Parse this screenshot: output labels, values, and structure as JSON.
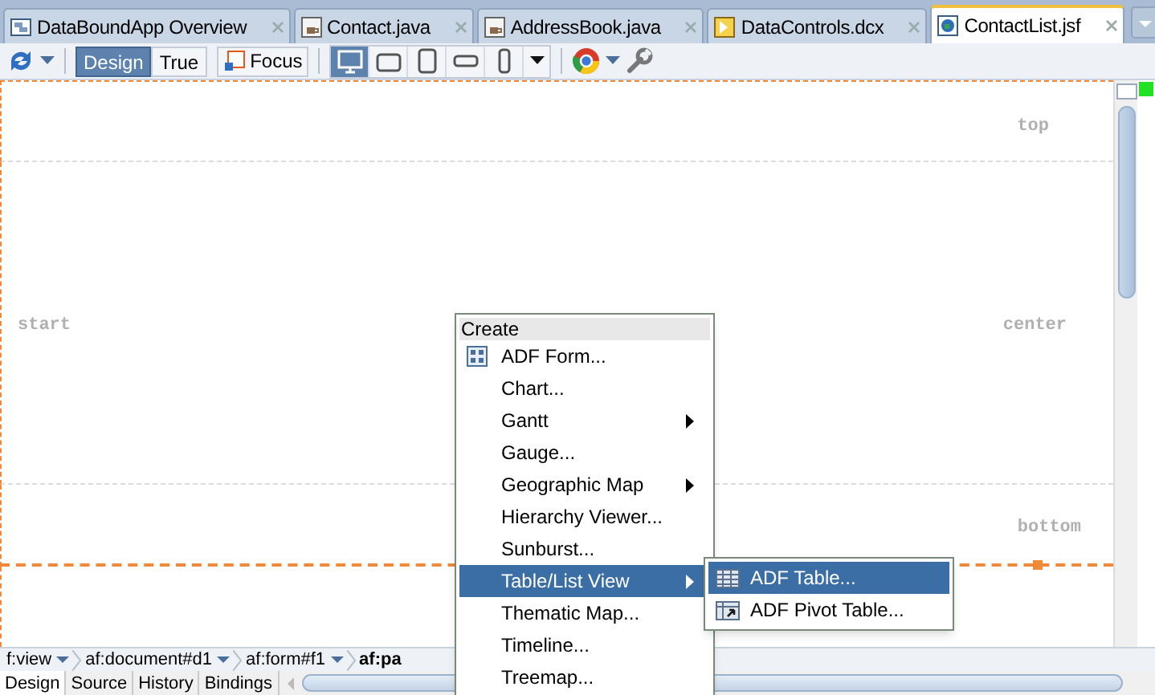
{
  "editor_tabs": [
    {
      "label": "DataBoundApp Overview",
      "kind": "overview",
      "selected": false
    },
    {
      "label": "Contact.java",
      "kind": "java",
      "selected": false
    },
    {
      "label": "AddressBook.java",
      "kind": "java",
      "selected": false
    },
    {
      "label": "DataControls.dcx",
      "kind": "dcx",
      "selected": false
    },
    {
      "label": "ContactList.jsf",
      "kind": "jsf",
      "selected": true
    }
  ],
  "toolbar": {
    "mode_buttons": [
      {
        "label": "Design",
        "selected": true
      },
      {
        "label": "True",
        "selected": false
      }
    ],
    "focus_button": {
      "label": "Focus"
    },
    "devices": [
      {
        "kind": "desktop",
        "selected": true
      },
      {
        "kind": "tablet-landscape",
        "selected": false
      },
      {
        "kind": "tablet-portrait",
        "selected": false
      },
      {
        "kind": "phone-landscape",
        "selected": false
      },
      {
        "kind": "phone-portrait",
        "selected": false
      }
    ]
  },
  "canvas": {
    "top": "top",
    "start": "start",
    "center": "center",
    "bottom": "bottom"
  },
  "breadcrumb": [
    {
      "label": "f:view",
      "current": false
    },
    {
      "label": "af:document#d1",
      "current": false
    },
    {
      "label": "af:form#f1",
      "current": false
    },
    {
      "label": "af:pa",
      "current": true
    }
  ],
  "bottom_tabs": [
    {
      "label": "Design",
      "selected": true
    },
    {
      "label": "Source",
      "selected": false
    },
    {
      "label": "History",
      "selected": false
    },
    {
      "label": "Bindings",
      "selected": false
    }
  ],
  "context_menu": {
    "header": "Create",
    "items": [
      {
        "label": "ADF Form...",
        "kind": "form",
        "submenu": false,
        "selected": false
      },
      {
        "label": "Chart...",
        "submenu": false,
        "selected": false
      },
      {
        "label": "Gantt",
        "submenu": true,
        "selected": false
      },
      {
        "label": "Gauge...",
        "submenu": false,
        "selected": false
      },
      {
        "label": "Geographic Map",
        "submenu": true,
        "selected": false
      },
      {
        "label": "Hierarchy Viewer...",
        "submenu": false,
        "selected": false
      },
      {
        "label": "Sunburst...",
        "submenu": false,
        "selected": false
      },
      {
        "label": "Table/List View",
        "submenu": true,
        "selected": true
      },
      {
        "label": "Thematic Map...",
        "submenu": false,
        "selected": false
      },
      {
        "label": "Timeline...",
        "submenu": false,
        "selected": false
      },
      {
        "label": "Treemap...",
        "submenu": false,
        "selected": false
      }
    ],
    "submenu": [
      {
        "label": "ADF Table...",
        "kind": "table",
        "selected": true
      },
      {
        "label": "ADF Pivot Table...",
        "kind": "pivot",
        "selected": false
      }
    ]
  }
}
